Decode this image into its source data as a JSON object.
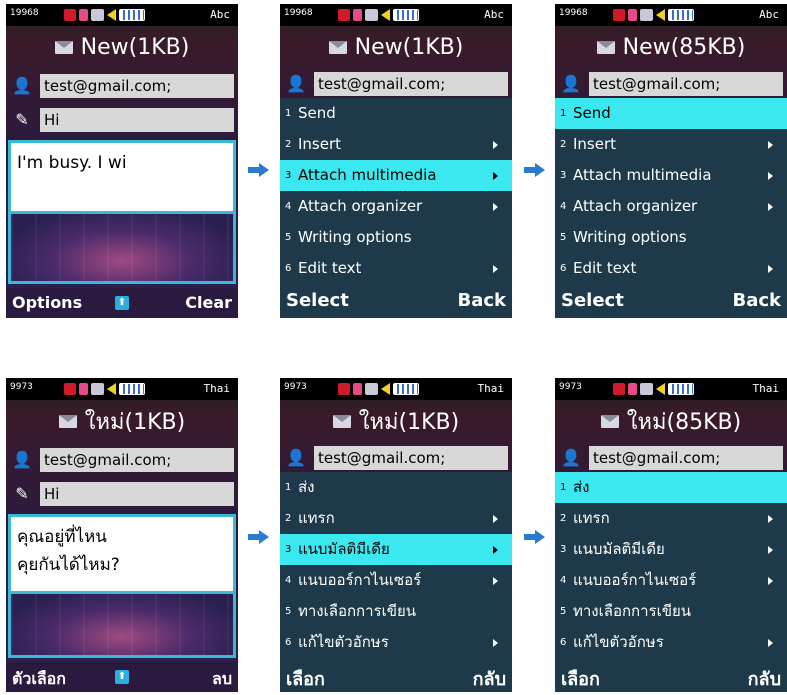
{
  "colors": {
    "highlight": "#3ce8f0",
    "menu_bg": "#1e3a4a",
    "body_border": "#3ab8d8",
    "arrow": "#2a7ad0"
  },
  "english": {
    "compose": {
      "signal": "19968",
      "input_mode": "Abc",
      "title": "New(1KB)",
      "to": "test@gmail.com;",
      "subject": "Hi",
      "body_lines": [
        "I'm busy. I wi"
      ],
      "soft_left": "Options",
      "soft_right": "Clear"
    },
    "menu1": {
      "signal": "19968",
      "input_mode": "Abc",
      "title": "New(1KB)",
      "to": "test@gmail.com;",
      "items": [
        {
          "num": "1",
          "label": "Send",
          "arrow": false
        },
        {
          "num": "2",
          "label": "Insert",
          "arrow": true
        },
        {
          "num": "3",
          "label": "Attach multimedia",
          "arrow": true
        },
        {
          "num": "4",
          "label": "Attach organizer",
          "arrow": true
        },
        {
          "num": "5",
          "label": "Writing options",
          "arrow": false
        },
        {
          "num": "6",
          "label": "Edit text",
          "arrow": true
        }
      ],
      "highlighted": 2,
      "soft_left": "Select",
      "soft_right": "Back"
    },
    "menu2": {
      "signal": "19968",
      "input_mode": "Abc",
      "title": "New(85KB)",
      "to": "test@gmail.com;",
      "items": [
        {
          "num": "1",
          "label": "Send",
          "arrow": false
        },
        {
          "num": "2",
          "label": "Insert",
          "arrow": true
        },
        {
          "num": "3",
          "label": "Attach multimedia",
          "arrow": true
        },
        {
          "num": "4",
          "label": "Attach organizer",
          "arrow": true
        },
        {
          "num": "5",
          "label": "Writing options",
          "arrow": false
        },
        {
          "num": "6",
          "label": "Edit text",
          "arrow": true
        }
      ],
      "highlighted": 0,
      "soft_left": "Select",
      "soft_right": "Back"
    }
  },
  "thai": {
    "compose": {
      "signal": "9973",
      "input_mode": "Thai",
      "title": "ใหม่(1KB)",
      "to": "test@gmail.com;",
      "subject": "Hi",
      "body_lines": [
        "คุณอยู่ที่ไหน",
        "คุยกันได้ไหม?"
      ],
      "soft_left": "ตัวเลือก",
      "soft_right": "ลบ"
    },
    "menu1": {
      "signal": "9973",
      "input_mode": "Thai",
      "title": "ใหม่(1KB)",
      "to": "test@gmail.com;",
      "items": [
        {
          "num": "1",
          "label": "ส่ง",
          "arrow": false
        },
        {
          "num": "2",
          "label": "แทรก",
          "arrow": true
        },
        {
          "num": "3",
          "label": "แนบมัลติมีเดีย",
          "arrow": true
        },
        {
          "num": "4",
          "label": "แนบออร์กาไนเซอร์",
          "arrow": true
        },
        {
          "num": "5",
          "label": "ทางเลือกการเขียน",
          "arrow": false
        },
        {
          "num": "6",
          "label": "แก้ไขตัวอักษร",
          "arrow": true
        }
      ],
      "highlighted": 2,
      "soft_left": "เลือก",
      "soft_right": "กลับ"
    },
    "menu2": {
      "signal": "9973",
      "input_mode": "Thai",
      "title": "ใหม่(85KB)",
      "to": "test@gmail.com;",
      "items": [
        {
          "num": "1",
          "label": "ส่ง",
          "arrow": false
        },
        {
          "num": "2",
          "label": "แทรก",
          "arrow": true
        },
        {
          "num": "3",
          "label": "แนบมัลติมีเดีย",
          "arrow": true
        },
        {
          "num": "4",
          "label": "แนบออร์กาไนเซอร์",
          "arrow": true
        },
        {
          "num": "5",
          "label": "ทางเลือกการเขียน",
          "arrow": false
        },
        {
          "num": "6",
          "label": "แก้ไขตัวอักษร",
          "arrow": true
        }
      ],
      "highlighted": 0,
      "soft_left": "เลือก",
      "soft_right": "กลับ"
    }
  }
}
